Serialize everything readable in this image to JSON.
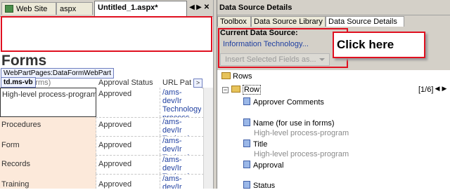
{
  "document_tabs": {
    "website": "Web Site",
    "aspx": "aspx",
    "untitled": "Untitled_1.aspx*",
    "prev_glyph": "◀",
    "next_glyph": "▶",
    "close_glyph": "✕"
  },
  "design_surface": {
    "page_title": "Forms",
    "webpart_label": "WebPartPages:DataFormWebPart",
    "selected_tag": "td.ms-vb",
    "column_headers": {
      "name": "r use in forms)",
      "approval": "Approval Status",
      "url": "URL Pat",
      "arrow": ">"
    },
    "rows": [
      {
        "name": "High-level process-program",
        "approval": "Approved",
        "url": "/ams-dev/Ir Technology process-pro"
      },
      {
        "name": "Procedures",
        "approval": "Approved",
        "url": "/ams-dev/Ir Technology"
      },
      {
        "name": "Form",
        "approval": "Approved",
        "url": "/ams-dev/Ir Technology"
      },
      {
        "name": "Records",
        "approval": "Approved",
        "url": "/ams-dev/Ir Technology"
      },
      {
        "name": "Training",
        "approval": "Approved",
        "url": "/ams-dev/Ir"
      }
    ]
  },
  "panel": {
    "title": "Data Source Details",
    "tabs": [
      "Toolbox",
      "Data Source Library",
      "Data Source Details"
    ],
    "current_ds_label": "Current Data Source:",
    "current_ds_value": "Information Technology...",
    "insert_button": "Insert Selected Fields as...",
    "callout": "Click here"
  },
  "tree": {
    "root": "Rows",
    "row_node": "Row",
    "pager": "[1/6]",
    "pager_prev": "◀",
    "pager_next": "▶",
    "expander": "−",
    "fields": [
      {
        "name": "Approver Comments",
        "value": ""
      },
      {
        "name": "Name (for use in forms)",
        "value": "High-level process-program"
      },
      {
        "name": "Title",
        "value": "High-level process-program"
      },
      {
        "name": "Approval",
        "value": ""
      },
      {
        "name": "Status",
        "value": ""
      }
    ]
  },
  "colors": {
    "callout_border": "#e01020",
    "link": "#1f3fa0",
    "chrome": "#d4d0c8",
    "row_highlight": "#fce9da"
  }
}
